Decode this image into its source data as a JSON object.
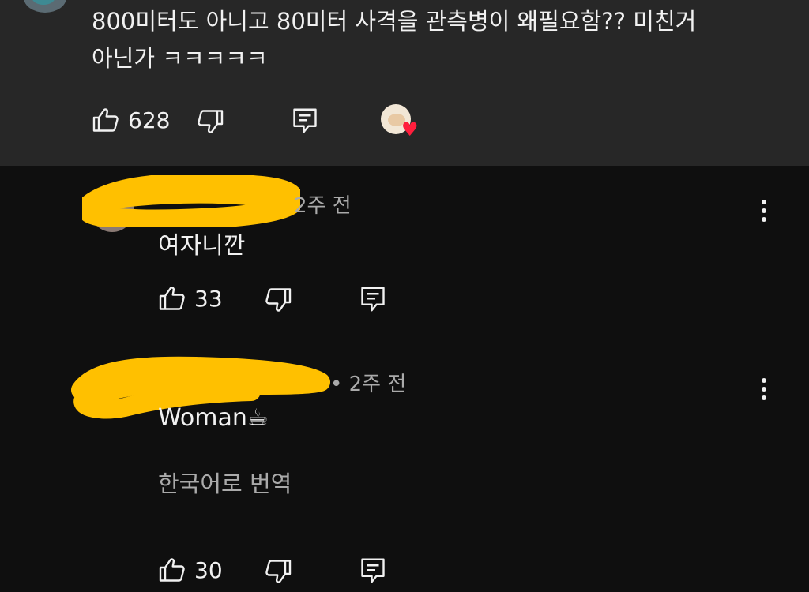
{
  "comment": {
    "text": "800미터도 아니고 80미터 사격을 관측병이 왜필요함?? 미친거\n아닌가 ㅋㅋㅋㅋㅋ",
    "likes": "628"
  },
  "replies": [
    {
      "timestamp": "2주 전",
      "text": "여자니깐",
      "likes": "33"
    },
    {
      "timestamp": "• 2주 전",
      "text": "Woman☕",
      "translate_label": "한국어로 번역",
      "likes": "30"
    }
  ],
  "colors": {
    "top_bg": "#272727",
    "page_bg": "#0f0f0f",
    "redaction": "#ffc000",
    "heart": "#ff1e3c"
  },
  "icons": [
    "thumb-up-icon",
    "thumb-down-icon",
    "reply-icon",
    "creator-heart-icon",
    "more-vert-icon"
  ]
}
